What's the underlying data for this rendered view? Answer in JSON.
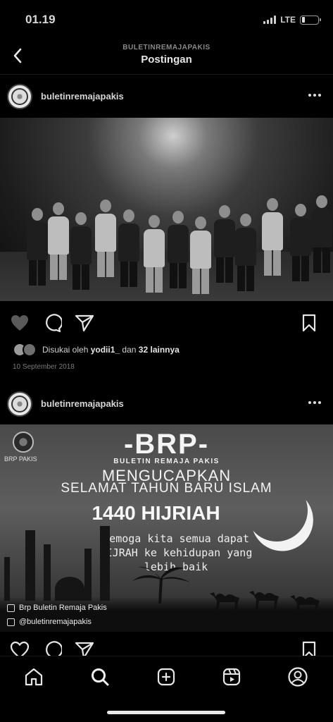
{
  "status_bar": {
    "time": "01.19",
    "network": "LTE"
  },
  "header": {
    "account": "BULETINREMAJAPAKIS",
    "title": "Postingan"
  },
  "posts": [
    {
      "username": "buletinremajapakis",
      "likes": {
        "prefix": "Disukai oleh",
        "user": "yodii1_",
        "middle": "dan",
        "count": "32 lainnya"
      },
      "date": "10 September 2018"
    },
    {
      "username": "buletinremajapakis",
      "image": {
        "logo_label": "BRP PAKIS",
        "brand": "-BRP-",
        "brand_sub": "BULETIN REMAJA PAKIS",
        "line1": "MENGUCAPKAN",
        "line2": "SELAMAT TAHUN BARU ISLAM",
        "hijri": "1440 HIJRIAH",
        "message": "semoga kita semua dapat HIJRAH ke kehidupan yang lebih baik",
        "facebook": "Brp Buletin Remaja Pakis",
        "instagram": "@buletinremajapakis"
      }
    }
  ],
  "icons": {
    "back": "chevron-left-icon",
    "more": "more-horizontal-icon",
    "like": "heart-icon",
    "comment": "comment-icon",
    "share": "send-icon",
    "save": "bookmark-icon",
    "home": "home-icon",
    "search": "search-icon",
    "add": "add-post-icon",
    "reels": "reels-icon",
    "profile": "profile-icon"
  },
  "colors": {
    "background": "#000000",
    "text": "#e6e6e6",
    "muted": "#7a7a7a"
  }
}
